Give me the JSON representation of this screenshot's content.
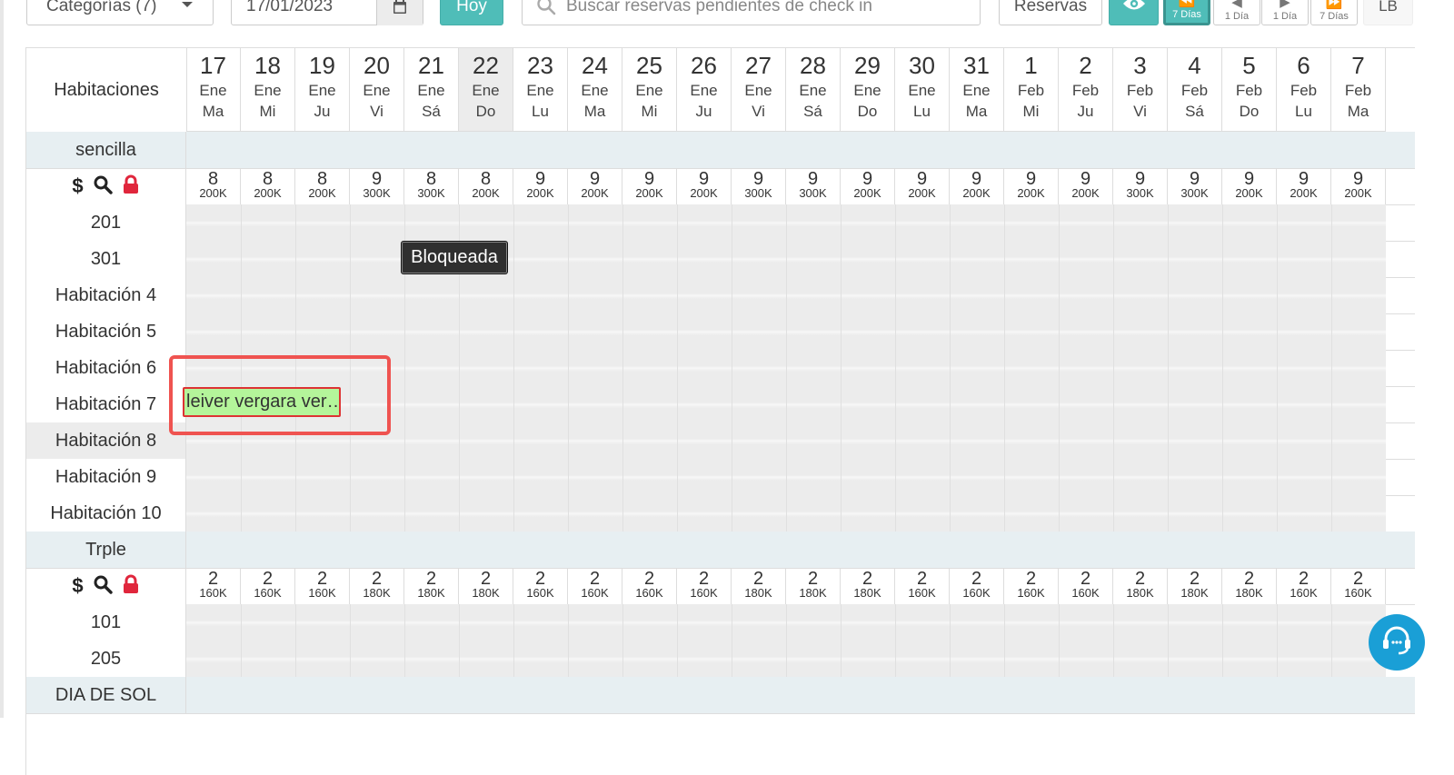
{
  "toolbar": {
    "categories_label": "Categorías (7)",
    "date_value": "17/01/2023",
    "today_label": "Hoy",
    "search_placeholder": "Buscar reservas pendientes de check in",
    "reservations_label": "Reservas",
    "nav": [
      {
        "label": "7 Días",
        "glyph": "⏪"
      },
      {
        "label": "1 Día",
        "glyph": "◀"
      },
      {
        "label": "1 Día",
        "glyph": "▶"
      },
      {
        "label": "7 Días",
        "glyph": "⏩"
      }
    ],
    "user_initials": "LB",
    "accent_color": "#4fbdb8"
  },
  "grid": {
    "rooms_header": "Habitaciones",
    "days": [
      {
        "d": "17",
        "m": "Ene",
        "w": "Ma"
      },
      {
        "d": "18",
        "m": "Ene",
        "w": "Mi"
      },
      {
        "d": "19",
        "m": "Ene",
        "w": "Ju"
      },
      {
        "d": "20",
        "m": "Ene",
        "w": "Vi"
      },
      {
        "d": "21",
        "m": "Ene",
        "w": "Sá"
      },
      {
        "d": "22",
        "m": "Ene",
        "w": "Do",
        "highlight": true
      },
      {
        "d": "23",
        "m": "Ene",
        "w": "Lu"
      },
      {
        "d": "24",
        "m": "Ene",
        "w": "Ma"
      },
      {
        "d": "25",
        "m": "Ene",
        "w": "Mi"
      },
      {
        "d": "26",
        "m": "Ene",
        "w": "Ju"
      },
      {
        "d": "27",
        "m": "Ene",
        "w": "Vi"
      },
      {
        "d": "28",
        "m": "Ene",
        "w": "Sá"
      },
      {
        "d": "29",
        "m": "Ene",
        "w": "Do"
      },
      {
        "d": "30",
        "m": "Ene",
        "w": "Lu"
      },
      {
        "d": "31",
        "m": "Ene",
        "w": "Ma"
      },
      {
        "d": "1",
        "m": "Feb",
        "w": "Mi"
      },
      {
        "d": "2",
        "m": "Feb",
        "w": "Ju"
      },
      {
        "d": "3",
        "m": "Feb",
        "w": "Vi"
      },
      {
        "d": "4",
        "m": "Feb",
        "w": "Sá"
      },
      {
        "d": "5",
        "m": "Feb",
        "w": "Do"
      },
      {
        "d": "6",
        "m": "Feb",
        "w": "Lu"
      },
      {
        "d": "7",
        "m": "Feb",
        "w": "Ma"
      }
    ],
    "categories": [
      {
        "name": "sencilla",
        "counts": [
          "8",
          "8",
          "8",
          "9",
          "8",
          "8",
          "9",
          "9",
          "9",
          "9",
          "9",
          "9",
          "9",
          "9",
          "9",
          "9",
          "9",
          "9",
          "9",
          "9",
          "9",
          "9"
        ],
        "prices": [
          "200K",
          "200K",
          "200K",
          "300K",
          "300K",
          "200K",
          "200K",
          "200K",
          "200K",
          "200K",
          "300K",
          "300K",
          "200K",
          "200K",
          "200K",
          "200K",
          "200K",
          "300K",
          "300K",
          "200K",
          "200K",
          "200K"
        ],
        "rooms": [
          {
            "name": "201"
          },
          {
            "name": "301"
          },
          {
            "name": "Habitación 4"
          },
          {
            "name": "Habitación 5"
          },
          {
            "name": "Habitación 6"
          },
          {
            "name": "Habitación 7"
          },
          {
            "name": "Habitación 8",
            "highlight": true
          },
          {
            "name": "Habitación 9"
          },
          {
            "name": "Habitación 10"
          }
        ]
      },
      {
        "name": "Trple",
        "counts": [
          "2",
          "2",
          "2",
          "2",
          "2",
          "2",
          "2",
          "2",
          "2",
          "2",
          "2",
          "2",
          "2",
          "2",
          "2",
          "2",
          "2",
          "2",
          "2",
          "2",
          "2",
          "2"
        ],
        "prices": [
          "160K",
          "160K",
          "160K",
          "180K",
          "180K",
          "180K",
          "160K",
          "160K",
          "160K",
          "160K",
          "180K",
          "180K",
          "180K",
          "160K",
          "160K",
          "160K",
          "160K",
          "180K",
          "180K",
          "180K",
          "160K",
          "160K"
        ],
        "rooms": [
          {
            "name": "101"
          },
          {
            "name": "205"
          }
        ]
      },
      {
        "name": "DIA DE SOL",
        "rooms": []
      }
    ],
    "blocked_label": "Bloqueada",
    "booking_label": "leiver vergara ver…",
    "booking_color": "#b4f59a",
    "blocked_color": "#2f2f2f"
  }
}
